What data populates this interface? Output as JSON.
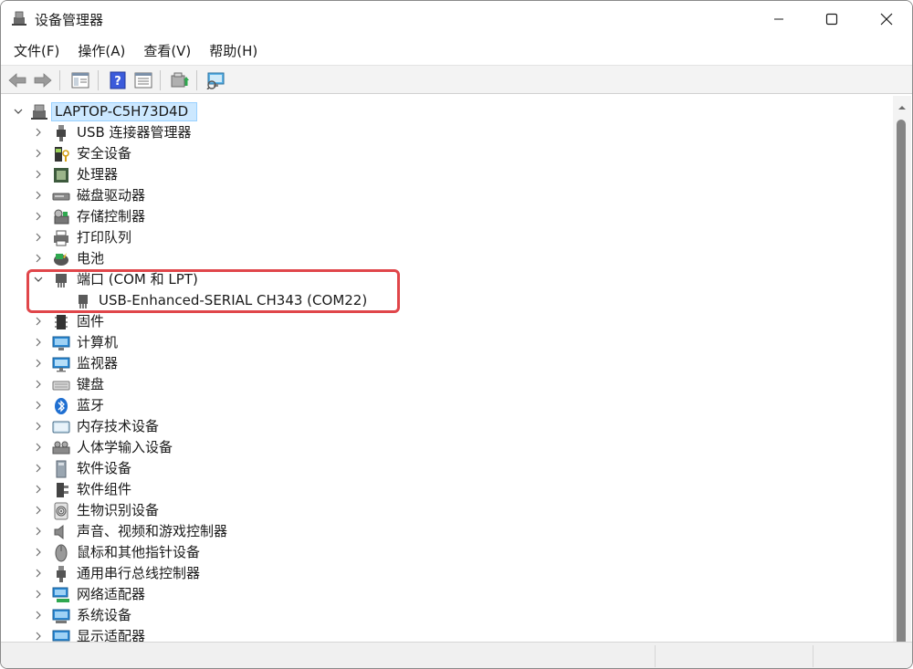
{
  "window": {
    "title": "设备管理器",
    "controls": {
      "minimize": "minimize-icon",
      "maximize": "maximize-icon",
      "close": "close-icon"
    }
  },
  "menu": [
    "文件(F)",
    "操作(A)",
    "查看(V)",
    "帮助(H)"
  ],
  "toolbar": [
    "back-icon",
    "forward-icon",
    "properties-view-icon",
    "help-icon",
    "details-view-icon",
    "update-driver-icon",
    "scan-hardware-icon"
  ],
  "tree": {
    "root": "LAPTOP-C5H73D4D",
    "categories": [
      {
        "label": "USB 连接器管理器",
        "icon": "usb-connector-icon",
        "expanded": false
      },
      {
        "label": "安全设备",
        "icon": "security-device-icon",
        "expanded": false
      },
      {
        "label": "处理器",
        "icon": "processor-icon",
        "expanded": false
      },
      {
        "label": "磁盘驱动器",
        "icon": "disk-drive-icon",
        "expanded": false
      },
      {
        "label": "存储控制器",
        "icon": "storage-controller-icon",
        "expanded": false
      },
      {
        "label": "打印队列",
        "icon": "printer-icon",
        "expanded": false
      },
      {
        "label": "电池",
        "icon": "battery-icon",
        "expanded": false
      },
      {
        "label": "端口 (COM 和 LPT)",
        "icon": "port-icon",
        "expanded": true,
        "children": [
          "USB-Enhanced-SERIAL CH343 (COM22)"
        ]
      },
      {
        "label": "固件",
        "icon": "firmware-icon",
        "expanded": false
      },
      {
        "label": "计算机",
        "icon": "computer-icon",
        "expanded": false
      },
      {
        "label": "监视器",
        "icon": "monitor-icon",
        "expanded": false
      },
      {
        "label": "键盘",
        "icon": "keyboard-icon",
        "expanded": false
      },
      {
        "label": "蓝牙",
        "icon": "bluetooth-icon",
        "expanded": false
      },
      {
        "label": "内存技术设备",
        "icon": "memory-tech-icon",
        "expanded": false
      },
      {
        "label": "人体学输入设备",
        "icon": "hid-icon",
        "expanded": false
      },
      {
        "label": "软件设备",
        "icon": "software-device-icon",
        "expanded": false
      },
      {
        "label": "软件组件",
        "icon": "software-component-icon",
        "expanded": false
      },
      {
        "label": "生物识别设备",
        "icon": "biometric-icon",
        "expanded": false
      },
      {
        "label": "声音、视频和游戏控制器",
        "icon": "sound-icon",
        "expanded": false
      },
      {
        "label": "鼠标和其他指针设备",
        "icon": "mouse-icon",
        "expanded": false
      },
      {
        "label": "通用串行总线控制器",
        "icon": "usb-controller-icon",
        "expanded": false
      },
      {
        "label": "网络适配器",
        "icon": "network-adapter-icon",
        "expanded": false
      },
      {
        "label": "系统设备",
        "icon": "system-device-icon",
        "expanded": false
      },
      {
        "label": "显示适配器",
        "icon": "display-adapter-icon",
        "expanded": false
      }
    ]
  },
  "colors": {
    "highlight_box": "#e0464a",
    "selection": "#cce8ff",
    "scroll_thumb": "#858585"
  }
}
